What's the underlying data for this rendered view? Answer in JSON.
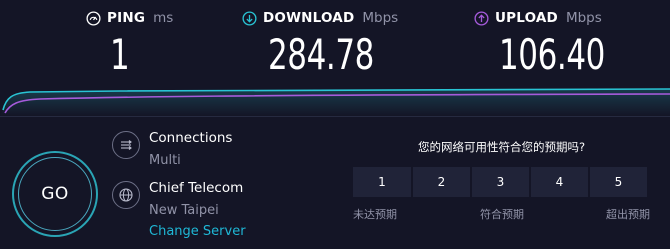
{
  "metrics": {
    "ping": {
      "label": "PING",
      "unit": "ms",
      "value": "1"
    },
    "download": {
      "label": "DOWNLOAD",
      "unit": "Mbps",
      "value": "284.78"
    },
    "upload": {
      "label": "UPLOAD",
      "unit": "Mbps",
      "value": "106.40"
    }
  },
  "go_label": "GO",
  "connections": {
    "title": "Connections",
    "value": "Multi"
  },
  "server": {
    "name": "Chief Telecom",
    "location": "New Taipei",
    "change_label": "Change Server"
  },
  "survey": {
    "question": "您的网络可用性符合您的预期吗?",
    "ratings": [
      "1",
      "2",
      "3",
      "4",
      "5"
    ],
    "low_label": "未达预期",
    "mid_label": "符合预期",
    "high_label": "超出预期"
  },
  "colors": {
    "background": "#141526",
    "download_accent": "#29c4d4",
    "upload_accent": "#a65bdb",
    "link": "#1fb8d6"
  }
}
